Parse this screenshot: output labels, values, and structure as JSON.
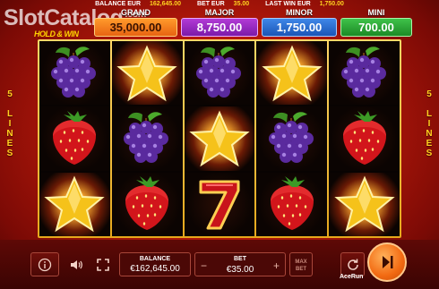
{
  "watermark": {
    "text": "SlotCatalog",
    "dot": ".com",
    "badge": "HOLD & WIN"
  },
  "top_info": {
    "balance_label": "BALANCE EUR",
    "balance_value": "162,645.00",
    "bet_label": "BET EUR",
    "bet_value": "35.00",
    "last_win_label": "LAST WIN EUR",
    "last_win_value": "1,750.00"
  },
  "jackpots": {
    "grand": {
      "label": "GRAND",
      "value": "35,000.00"
    },
    "major": {
      "label": "MAJOR",
      "value": "8,750.00"
    },
    "minor": {
      "label": "MINOR",
      "value": "1,750.00"
    },
    "mini": {
      "label": "MINI",
      "value": "700.00"
    }
  },
  "lines": {
    "left": "5 LINES",
    "right": "5 LINES"
  },
  "reels": [
    [
      "grapes",
      "strawberry",
      "star"
    ],
    [
      "star",
      "grapes",
      "strawberry"
    ],
    [
      "grapes",
      "star",
      "seven"
    ],
    [
      "star",
      "grapes",
      "strawberry"
    ],
    [
      "grapes",
      "strawberry",
      "star"
    ]
  ],
  "controls": {
    "info_icon": "info-icon",
    "sound_icon": "speaker-icon",
    "fullscreen_icon": "fullscreen-icon",
    "balance_label": "BALANCE",
    "balance_value": "€162,645.00",
    "bet_label": "BET",
    "bet_value": "€35.00",
    "bet_minus": "−",
    "bet_plus": "+",
    "max_bet_line1": "MAX",
    "max_bet_line2": "BET",
    "autoplay_icon": "autoplay-icon",
    "spin_icon": "play-icon",
    "provider": "AceRun"
  },
  "colors": {
    "background": "#b3180a",
    "accent": "#ffd21f",
    "spin": "#f26a12"
  }
}
